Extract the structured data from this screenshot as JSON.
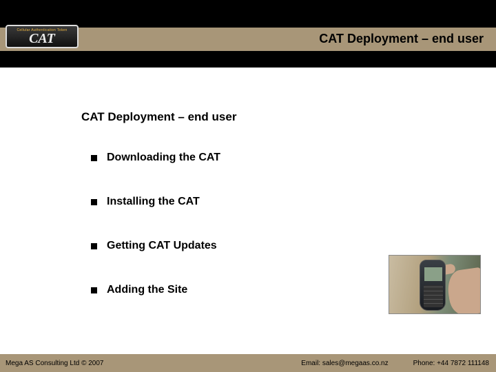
{
  "header": {
    "title": "CAT Deployment – end user"
  },
  "logo": {
    "subline": "Cellular Authentication Token",
    "main": "CAT"
  },
  "content": {
    "subtitle": "CAT Deployment – end user",
    "bullets": [
      "Downloading the CAT",
      "Installing the CAT",
      "Getting CAT Updates",
      "Adding the Site"
    ]
  },
  "image": {
    "name": "mobile-phone-in-hand-photo"
  },
  "footer": {
    "left": "Mega AS Consulting Ltd © 2007",
    "mid": "Email: sales@megaas.co.nz",
    "right": "Phone: +44 7872 111148"
  }
}
